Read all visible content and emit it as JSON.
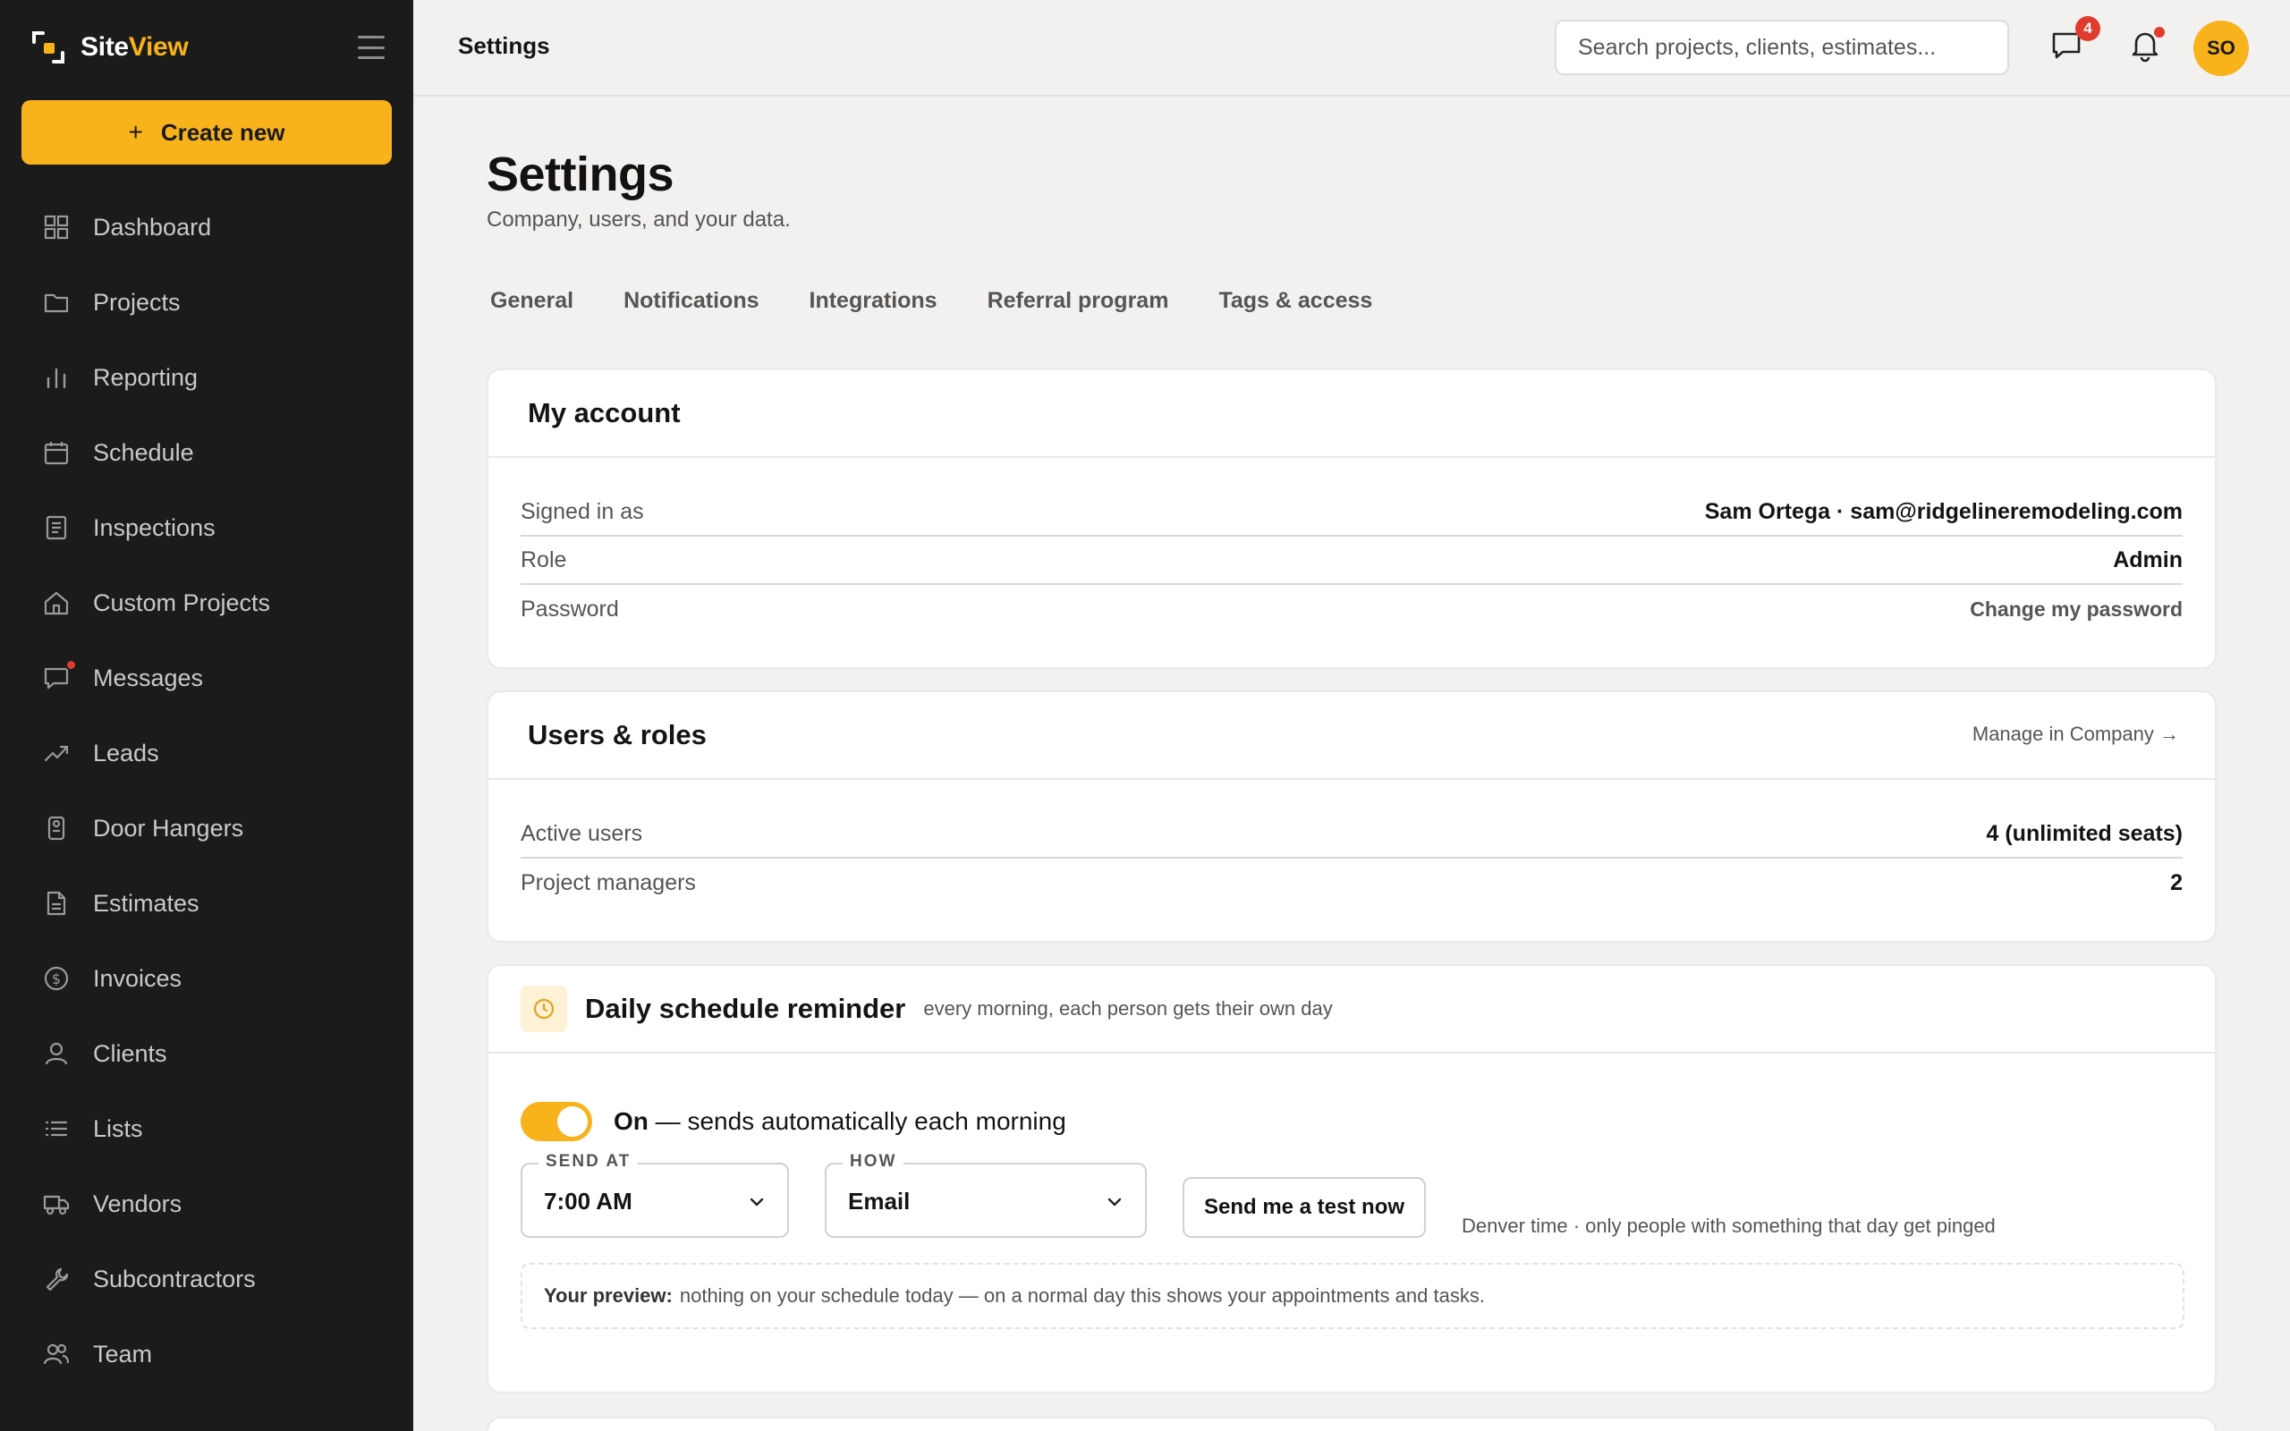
{
  "brand": {
    "name_part1": "Site",
    "name_part2": "View"
  },
  "sidebar": {
    "create_label": "Create new",
    "items": [
      {
        "label": "Dashboard",
        "icon": "dashboard-icon"
      },
      {
        "label": "Projects",
        "icon": "folder-icon"
      },
      {
        "label": "Reporting",
        "icon": "bar-chart-icon"
      },
      {
        "label": "Schedule",
        "icon": "calendar-icon"
      },
      {
        "label": "Inspections",
        "icon": "clipboard-icon"
      },
      {
        "label": "Custom Projects",
        "icon": "home-icon"
      },
      {
        "label": "Messages",
        "icon": "message-icon"
      },
      {
        "label": "Leads",
        "icon": "trending-up-icon"
      },
      {
        "label": "Door Hangers",
        "icon": "door-hanger-icon"
      },
      {
        "label": "Estimates",
        "icon": "document-icon"
      },
      {
        "label": "Invoices",
        "icon": "dollar-icon"
      },
      {
        "label": "Clients",
        "icon": "user-icon"
      },
      {
        "label": "Lists",
        "icon": "list-icon"
      },
      {
        "label": "Vendors",
        "icon": "truck-icon"
      },
      {
        "label": "Subcontractors",
        "icon": "wrench-icon"
      },
      {
        "label": "Team",
        "icon": "team-icon"
      }
    ]
  },
  "topbar": {
    "title": "Settings",
    "search_placeholder": "Search projects, clients, estimates...",
    "messages_count": "4",
    "avatar_initials": "SO"
  },
  "page": {
    "title": "Settings",
    "subtitle": "Company, users, and your data.",
    "tabs": [
      "General",
      "Notifications",
      "Integrations",
      "Referral program",
      "Tags & access"
    ]
  },
  "my_account": {
    "title": "My account",
    "rows": [
      {
        "label": "Signed in as",
        "value": "Sam Ortega · sam@ridgelineremodeling.com"
      },
      {
        "label": "Role",
        "value": "Admin"
      },
      {
        "label": "Password",
        "value": "Change my password"
      }
    ]
  },
  "users_roles": {
    "title": "Users & roles",
    "link": "Manage in Company →",
    "rows": [
      {
        "label": "Active users",
        "value": "4 (unlimited seats)"
      },
      {
        "label": "Project managers",
        "value": "2"
      }
    ]
  },
  "reminder": {
    "title": "Daily schedule reminder",
    "subtitle": "every morning, each person gets their own day",
    "toggle_state": "On",
    "toggle_text": " — sends automatically each morning",
    "send_at_label": "SEND AT",
    "send_at_value": "7:00 AM",
    "how_label": "HOW",
    "how_value": "Email",
    "test_button": "Send me a test now",
    "timezone_note": "Denver time · only people with something that day get pinged",
    "preview_label": "Your preview:",
    "preview_text": "nothing on your schedule today — on a normal day this shows your appointments and tasks."
  },
  "colors": {
    "accent": "#f8b21c",
    "sidebar_bg": "#1b1b1b",
    "alert": "#e23b2e"
  }
}
